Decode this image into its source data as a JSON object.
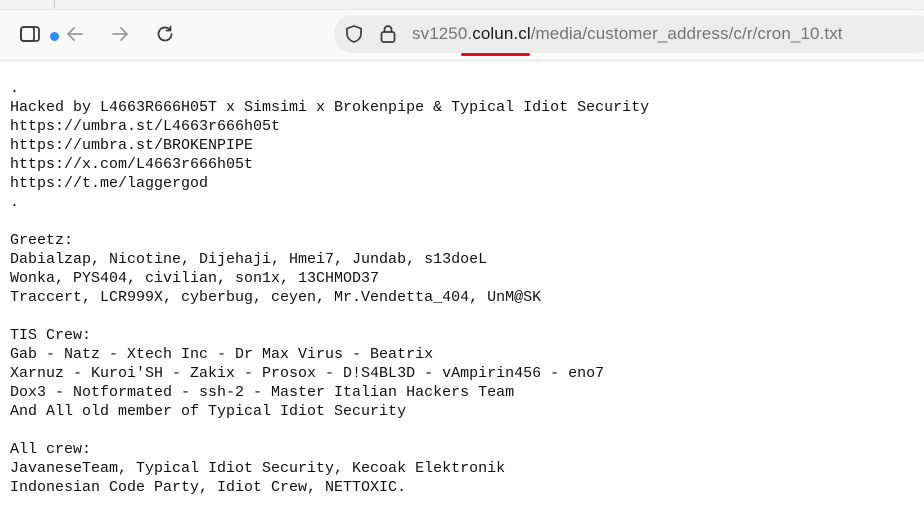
{
  "browser": {
    "url_prefix": "sv1250.",
    "url_domain": "colun.cl",
    "url_path": "/media/customer_address/c/r/cron_10.txt",
    "accent_color": "#2d8cff",
    "underline_color": "#d61313"
  },
  "icons": {
    "sidebar": "sidebar-icon",
    "back": "arrow-left-icon",
    "forward": "arrow-right-icon",
    "reload": "reload-icon",
    "shield": "shield-icon",
    "lock": "lock-icon"
  },
  "document": {
    "lines": [
      ".",
      "Hacked by L4663R666H05T x Simsimi x Brokenpipe & Typical Idiot Security",
      "https://umbra.st/L4663r666h05t",
      "https://umbra.st/BROKENPIPE",
      "https://x.com/L4663r666h05t",
      "https://t.me/laggergod",
      ".",
      "",
      "Greetz:",
      "Dabialzap, Nicotine, Dijehaji, Hmei7, Jundab, s13doeL",
      "Wonka, PYS404, civilian, son1x, 13CHMOD37",
      "Traccert, LCR999X, cyberbug, ceyen, Mr.Vendetta_404, UnM@SK",
      "",
      "TIS Crew:",
      "Gab - Natz - Xtech Inc - Dr Max Virus - Beatrix",
      "Xarnuz - Kuroi'SH - Zakix - Prosox - D!S4BL3D - vAmpirin456 - eno7",
      "Dox3 - Notformated - ssh-2 - Master Italian Hackers Team",
      "And All old member of Typical Idiot Security",
      "",
      "All crew:",
      "JavaneseTeam, Typical Idiot Security, Kecoak Elektronik",
      "Indonesian Code Party, Idiot Crew, NETTOXIC."
    ]
  }
}
